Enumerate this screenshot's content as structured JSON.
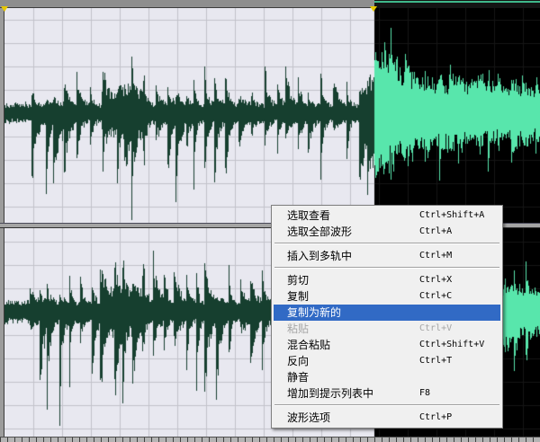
{
  "colors": {
    "selection_background": "#e8e8f0",
    "selection_grid": "#c2c2ca",
    "selection_waveform": "#163f2f",
    "unselected_background": "#000000",
    "unselected_grid": "#161616",
    "unselected_waveform": "#58e6ac",
    "marker": "#e8c800",
    "menu_background": "#f0f0f0",
    "menu_highlight": "#316ac5",
    "menu_highlight_text": "#ffffff",
    "menu_disabled_text": "#a6a6a6"
  },
  "selection_markers": {
    "start_icon": "selection-start-marker-icon",
    "end_icon": "selection-end-marker-icon"
  },
  "context_menu": {
    "items": [
      {
        "label": "选取查看",
        "shortcut": "Ctrl+Shift+A"
      },
      {
        "label": "选取全部波形",
        "shortcut": "Ctrl+A"
      },
      {
        "separator": true
      },
      {
        "label": "插入到多轨中",
        "shortcut": "Ctrl+M"
      },
      {
        "separator": true
      },
      {
        "label": "剪切",
        "shortcut": "Ctrl+X"
      },
      {
        "label": "复制",
        "shortcut": "Ctrl+C"
      },
      {
        "label": "复制为新的",
        "highlighted": true
      },
      {
        "label": "粘贴",
        "shortcut": "Ctrl+V",
        "disabled": true
      },
      {
        "label": "混合粘贴",
        "shortcut": "Ctrl+Shift+V"
      },
      {
        "label": "反向",
        "shortcut": "Ctrl+T"
      },
      {
        "label": "静音"
      },
      {
        "label": "增加到提示列表中",
        "shortcut": "F8"
      },
      {
        "separator": true
      },
      {
        "label": "波形选项",
        "shortcut": "Ctrl+P"
      }
    ]
  }
}
